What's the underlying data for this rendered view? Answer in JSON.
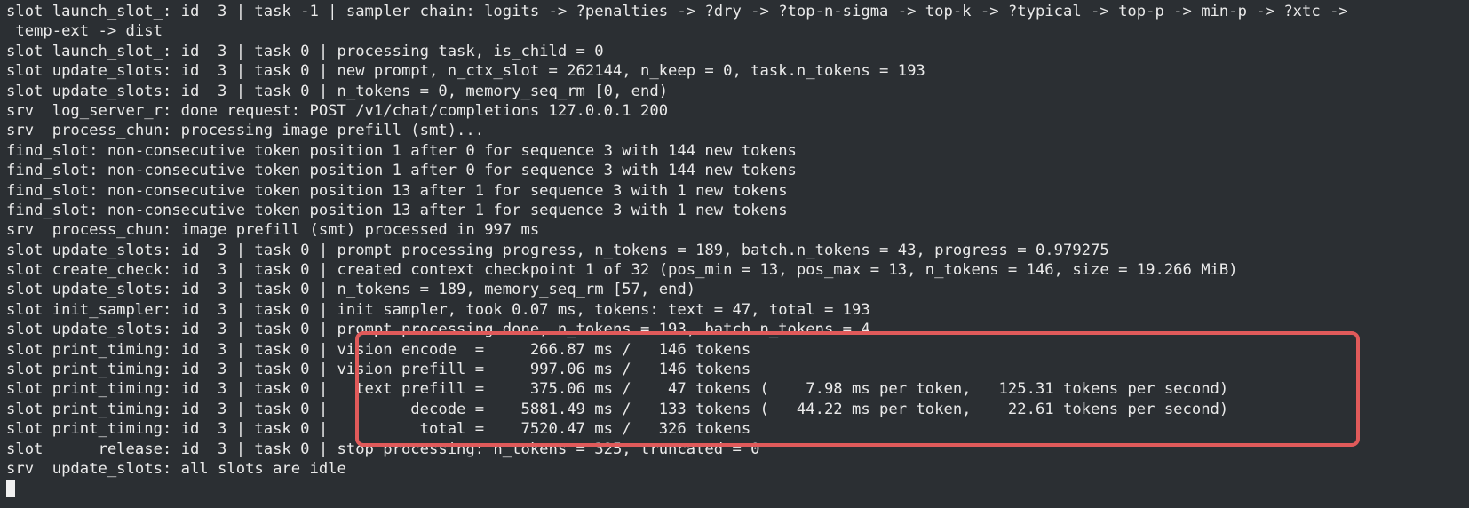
{
  "terminal": {
    "lines": [
      "slot launch_slot_: id  3 | task -1 | sampler chain: logits -> ?penalties -> ?dry -> ?top-n-sigma -> top-k -> ?typical -> top-p -> min-p -> ?xtc ->",
      " temp-ext -> dist",
      "slot launch_slot_: id  3 | task 0 | processing task, is_child = 0",
      "slot update_slots: id  3 | task 0 | new prompt, n_ctx_slot = 262144, n_keep = 0, task.n_tokens = 193",
      "slot update_slots: id  3 | task 0 | n_tokens = 0, memory_seq_rm [0, end)",
      "srv  log_server_r: done request: POST /v1/chat/completions 127.0.0.1 200",
      "srv  process_chun: processing image prefill (smt)...",
      "find_slot: non-consecutive token position 1 after 0 for sequence 3 with 144 new tokens",
      "find_slot: non-consecutive token position 1 after 0 for sequence 3 with 144 new tokens",
      "find_slot: non-consecutive token position 13 after 1 for sequence 3 with 1 new tokens",
      "find_slot: non-consecutive token position 13 after 1 for sequence 3 with 1 new tokens",
      "srv  process_chun: image prefill (smt) processed in 997 ms",
      "slot update_slots: id  3 | task 0 | prompt processing progress, n_tokens = 189, batch.n_tokens = 43, progress = 0.979275",
      "slot create_check: id  3 | task 0 | created context checkpoint 1 of 32 (pos_min = 13, pos_max = 13, n_tokens = 146, size = 19.266 MiB)",
      "slot update_slots: id  3 | task 0 | n_tokens = 189, memory_seq_rm [57, end)",
      "slot init_sampler: id  3 | task 0 | init sampler, took 0.07 ms, tokens: text = 47, total = 193",
      "slot update_slots: id  3 | task 0 | prompt processing done, n_tokens = 193, batch.n_tokens = 4",
      "slot print_timing: id  3 | task 0 | vision encode  =     266.87 ms /   146 tokens",
      "slot print_timing: id  3 | task 0 | vision prefill =     997.06 ms /   146 tokens",
      "slot print_timing: id  3 | task 0 |   text prefill =     375.06 ms /    47 tokens (    7.98 ms per token,   125.31 tokens per second)",
      "slot print_timing: id  3 | task 0 |         decode =    5881.49 ms /   133 tokens (   44.22 ms per token,    22.61 tokens per second)",
      "slot print_timing: id  3 | task 0 |          total =    7520.47 ms /   326 tokens",
      "slot      release: id  3 | task 0 | stop processing: n_tokens = 325, truncated = 0",
      "srv  update_slots: all slots are idle"
    ]
  },
  "colors": {
    "background": "#2b2f33",
    "text": "#eaeaea",
    "highlight_border": "#e05a5a",
    "cursor": "#f0f0f0"
  }
}
